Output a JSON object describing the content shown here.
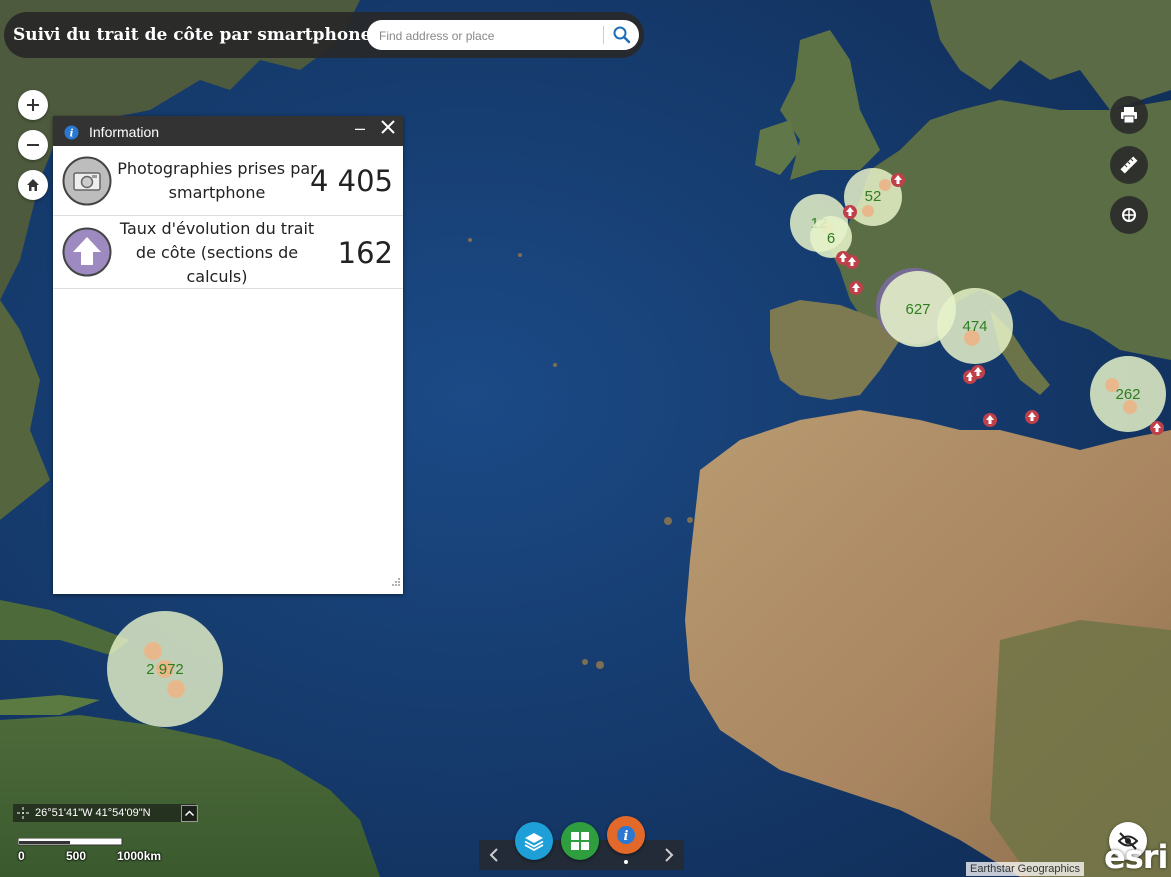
{
  "app": {
    "title": "Suivi du trait de côte par smartphone :"
  },
  "search": {
    "placeholder": "Find address or place"
  },
  "info_panel": {
    "title": "Information",
    "minimize_label": "–",
    "rows": [
      {
        "label": "Photographies prises par smartphone",
        "value": "4 405",
        "icon": "camera-icon"
      },
      {
        "label": "Taux d'évolution du trait de côte (sections de calculs)",
        "value": "162",
        "icon": "arrow-up-icon"
      }
    ]
  },
  "clusters": [
    {
      "count": "2 972"
    },
    {
      "count": "627"
    },
    {
      "count": "474"
    },
    {
      "count": "262"
    },
    {
      "count": "52"
    },
    {
      "count": "12"
    },
    {
      "count": "6"
    }
  ],
  "coordinates": {
    "text": "26°51'41\"W 41°54'09\"N"
  },
  "scale": {
    "labels": [
      "0",
      "500",
      "1000km"
    ]
  },
  "attribution": "Earthstar Geographics",
  "logo": "esri",
  "colors": {
    "cluster_fill": "#e6f2c8",
    "cluster_text": "#2f7d1f",
    "arrow_marker": "#c0404a",
    "widget_layers": "#1e9fd8",
    "widget_grid": "#2e9e3f",
    "widget_info": "#e2692a"
  }
}
